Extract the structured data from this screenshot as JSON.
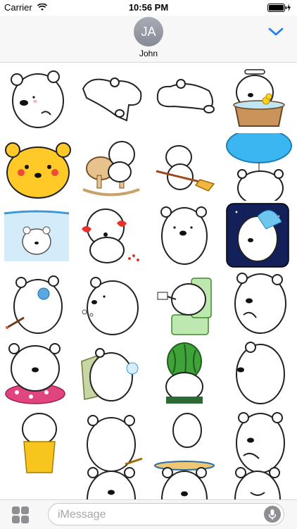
{
  "status_bar": {
    "carrier": "Carrier",
    "time": "10:56 PM"
  },
  "header": {
    "avatar_initials": "JA",
    "contact_name": "John"
  },
  "input": {
    "placeholder": "iMessage"
  },
  "icons": {
    "collapse": "chevron-down-icon",
    "apps": "app-drawer-icon",
    "mic": "microphone-icon",
    "wifi": "wifi-icon",
    "battery": "battery-icon"
  },
  "colors": {
    "accent": "#1a7cf6",
    "header_bg": "#f7f7f7"
  },
  "stickers": [
    {
      "description": "bear-thinking"
    },
    {
      "description": "bear-lying-down"
    },
    {
      "description": "bear-stretching"
    },
    {
      "description": "bear-bathtub-duck"
    },
    {
      "description": "yellow-bear"
    },
    {
      "description": "bear-rocking-horse"
    },
    {
      "description": "bear-broom"
    },
    {
      "description": "bear-balloon"
    },
    {
      "description": "bear-under-ice"
    },
    {
      "description": "bear-red-flowers"
    },
    {
      "description": "bear-standing"
    },
    {
      "description": "bear-night-sky"
    },
    {
      "description": "bear-fan-pointing"
    },
    {
      "description": "bear-sighing"
    },
    {
      "description": "bear-on-toilet"
    },
    {
      "description": "bear-hand-on-mouth"
    },
    {
      "description": "bear-on-cushion"
    },
    {
      "description": "bear-bubble"
    },
    {
      "description": "bear-watermelon"
    },
    {
      "description": "bear-side-view"
    },
    {
      "description": "bear-in-yellow-bag"
    },
    {
      "description": "bear-from-behind"
    },
    {
      "description": "bear-trampoline"
    },
    {
      "description": "bear-covering-mouth"
    },
    {
      "description": "bear-partial-1"
    },
    {
      "description": "bear-partial-2"
    },
    {
      "description": "bear-partial-3"
    }
  ]
}
